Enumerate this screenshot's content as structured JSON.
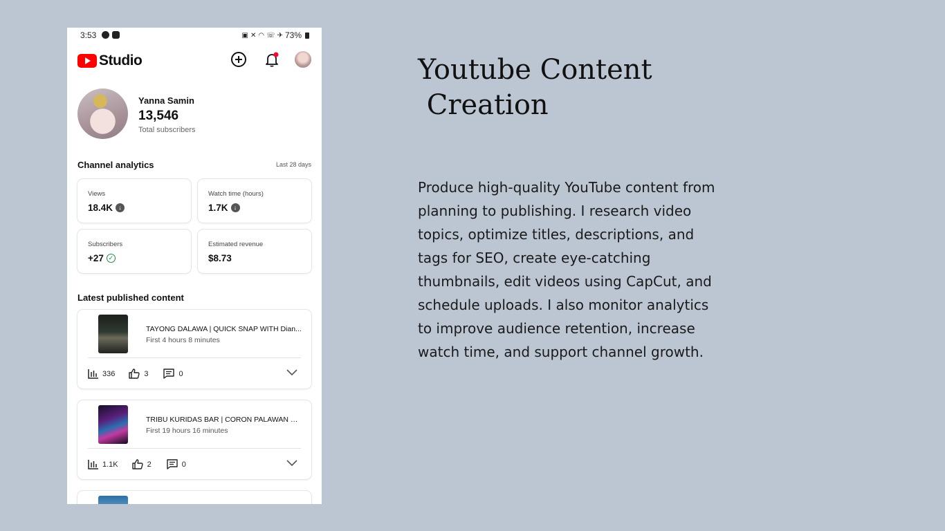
{
  "statusbar": {
    "time": "3:53",
    "battery": "73%"
  },
  "header": {
    "logo_text": "Studio"
  },
  "profile": {
    "name": "Yanna Samin",
    "subscribers": "13,546",
    "subscribers_label": "Total subscribers"
  },
  "analytics": {
    "title": "Channel analytics",
    "range": "Last 28 days",
    "cards": [
      {
        "label": "Views",
        "value": "18.4K"
      },
      {
        "label": "Watch time (hours)",
        "value": "1.7K"
      },
      {
        "label": "Subscribers",
        "value": "+27"
      },
      {
        "label": "Estimated revenue",
        "value": "$8.73"
      }
    ]
  },
  "latest": {
    "title": "Latest published content",
    "items": [
      {
        "title": "TAYONG DALAWA | QUICK SNAP WITH Dian...",
        "subtitle": "First 4 hours 8 minutes",
        "views": "336",
        "likes": "3",
        "comments": "0"
      },
      {
        "title": "TRIBU KURIDAS BAR | CORON PALAWAN #s...",
        "subtitle": "First 19 hours 16 minutes",
        "views": "1.1K",
        "likes": "2",
        "comments": "0"
      }
    ]
  },
  "right": {
    "title": "Youtube Content\n Creation",
    "body": "Produce high-quality YouTube content from planning to publishing. I research video topics, optimize titles, descriptions, and tags for SEO, create eye-catching thumbnails, edit videos using CapCut, and schedule uploads. I also monitor analytics to improve audience retention, increase watch time, and support channel growth."
  },
  "colors": {
    "background": "#bcc6d3",
    "youtube_red": "#ff0000",
    "check_green": "#1e8e3e"
  }
}
